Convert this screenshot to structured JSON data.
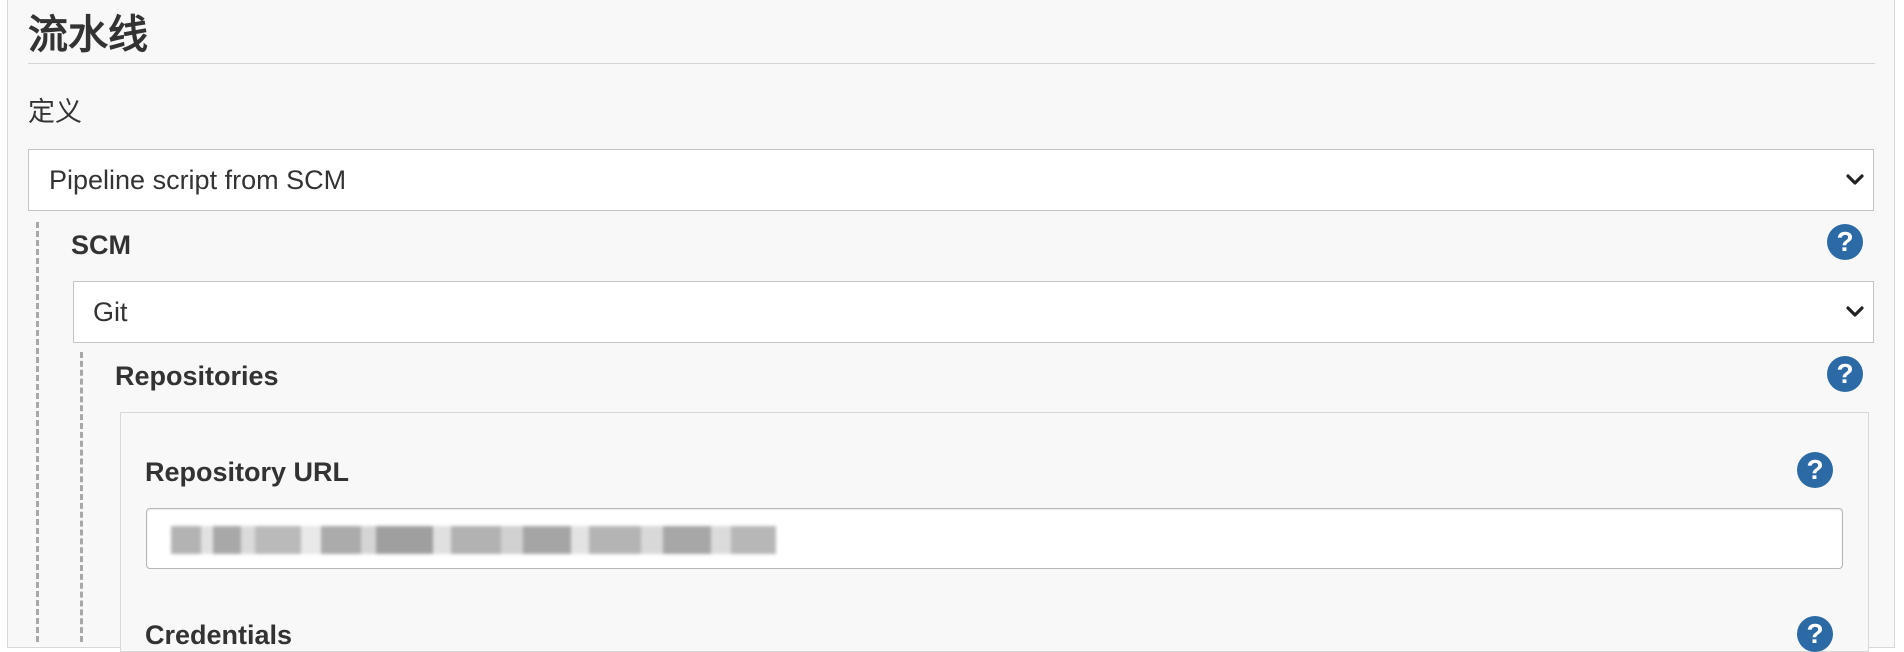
{
  "section": {
    "title": "流水线"
  },
  "definition": {
    "label": "定义",
    "selected": "Pipeline script from SCM"
  },
  "scm": {
    "label": "SCM",
    "selected": "Git"
  },
  "repositories": {
    "label": "Repositories",
    "repository_url_label": "Repository URL",
    "repository_url_value": "",
    "credentials_label": "Credentials"
  },
  "colors": {
    "panel_background": "#f8f8f8",
    "help_icon": "#2c6aa6",
    "dashed_line": "#a8a8a8"
  },
  "icons": {
    "help": "help-icon",
    "dropdown": "chevron-down-icon"
  }
}
